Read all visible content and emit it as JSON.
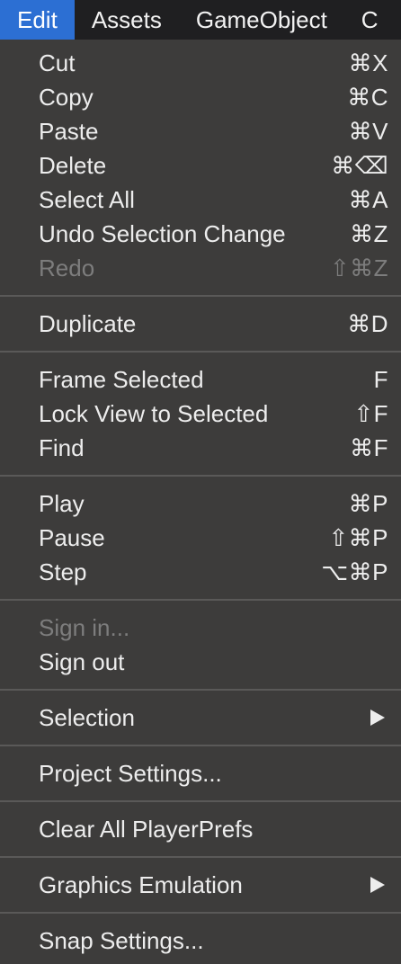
{
  "menubar": {
    "items": [
      {
        "label": "Edit",
        "active": true
      },
      {
        "label": "Assets"
      },
      {
        "label": "GameObject"
      },
      {
        "label": "C"
      }
    ]
  },
  "menu": {
    "groups": [
      [
        {
          "label": "Cut",
          "shortcut": "⌘X",
          "enabled": true
        },
        {
          "label": "Copy",
          "shortcut": "⌘C",
          "enabled": true
        },
        {
          "label": "Paste",
          "shortcut": "⌘V",
          "enabled": true
        },
        {
          "label": "Delete",
          "shortcut": "⌘⌫",
          "enabled": true
        },
        {
          "label": "Select All",
          "shortcut": "⌘A",
          "enabled": true
        },
        {
          "label": "Undo Selection Change",
          "shortcut": "⌘Z",
          "enabled": true
        },
        {
          "label": "Redo",
          "shortcut": "⇧⌘Z",
          "enabled": false
        }
      ],
      [
        {
          "label": "Duplicate",
          "shortcut": "⌘D",
          "enabled": true
        }
      ],
      [
        {
          "label": "Frame Selected",
          "shortcut": "F",
          "enabled": true
        },
        {
          "label": "Lock View to Selected",
          "shortcut": "⇧F",
          "enabled": true
        },
        {
          "label": "Find",
          "shortcut": "⌘F",
          "enabled": true
        }
      ],
      [
        {
          "label": "Play",
          "shortcut": "⌘P",
          "enabled": true
        },
        {
          "label": "Pause",
          "shortcut": "⇧⌘P",
          "enabled": true
        },
        {
          "label": "Step",
          "shortcut": "⌥⌘P",
          "enabled": true
        }
      ],
      [
        {
          "label": "Sign in...",
          "shortcut": "",
          "enabled": false
        },
        {
          "label": "Sign out",
          "shortcut": "",
          "enabled": true
        }
      ],
      [
        {
          "label": "Selection",
          "shortcut": "",
          "enabled": true,
          "submenu": true
        }
      ],
      [
        {
          "label": "Project Settings...",
          "shortcut": "",
          "enabled": true
        }
      ],
      [
        {
          "label": "Clear All PlayerPrefs",
          "shortcut": "",
          "enabled": true
        }
      ],
      [
        {
          "label": "Graphics Emulation",
          "shortcut": "",
          "enabled": true,
          "submenu": true
        }
      ],
      [
        {
          "label": "Snap Settings...",
          "shortcut": "",
          "enabled": true
        }
      ]
    ]
  },
  "colors": {
    "menubar_bg": "#1f1f21",
    "active_bg": "#2c6fd3",
    "menu_bg": "#3d3c3b",
    "text": "#ededed",
    "disabled_text": "#7d7d7d",
    "separator": "#5a5958"
  }
}
